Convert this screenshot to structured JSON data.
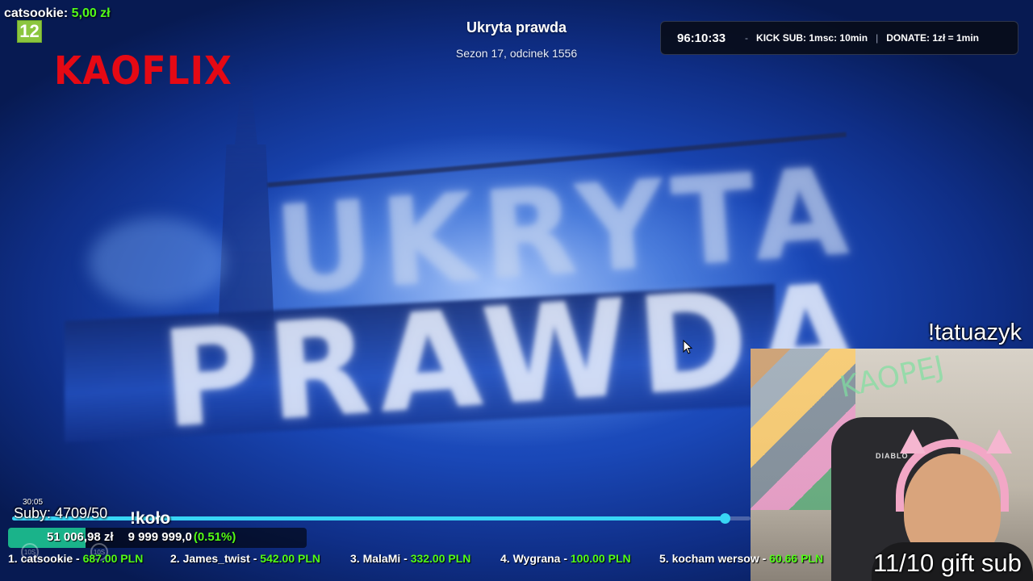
{
  "episode": {
    "title": "Ukryta prawda",
    "subtitle": "Sezon 17, odcinek 1556",
    "art_line1": "UKRYTA",
    "art_line2": "PRAWDA"
  },
  "donation_alert": {
    "user": "catsookie:",
    "amount": "5,00 zł"
  },
  "age_rating": "12",
  "logo": "KAOFLIX",
  "subathon": {
    "timer": "96:10:33",
    "rule_sub": "KICK SUB: 1msc: 10min",
    "rule_donate": "DONATE: 1zł = 1min",
    "separator_dash": "-",
    "separator_bar": "|"
  },
  "webcam": {
    "command": "!tatuazyk",
    "chair_brand": "DIABLO",
    "neon_text": "KAOPEJ",
    "gift_text": "11/10 gift sub"
  },
  "player": {
    "time": "30:05",
    "progress": 0.965
  },
  "goals": {
    "subs_text": "Suby: 4709/50",
    "command": "!koło",
    "amount": "51 006,98 zł",
    "target": "9 999 999,0",
    "percent": "(0.51%)",
    "fill": 0.26,
    "back_icon": "10S",
    "fwd_icon": "10S"
  },
  "leaderboard": [
    {
      "rank": "1. catsookie - ",
      "amount": "687.00 PLN"
    },
    {
      "rank": "2. James_twist - ",
      "amount": "542.00 PLN"
    },
    {
      "rank": "3. MalaMi - ",
      "amount": "332.00 PLN"
    },
    {
      "rank": "4. Wygrana - ",
      "amount": "100.00 PLN"
    },
    {
      "rank": "5. kocham wersow - ",
      "amount": "60.66 PLN"
    }
  ],
  "colors": {
    "accent_green": "#53fc18",
    "logo_red": "#e50914",
    "progress_cyan": "#38d6f5",
    "badge_green": "#8cc63f"
  }
}
